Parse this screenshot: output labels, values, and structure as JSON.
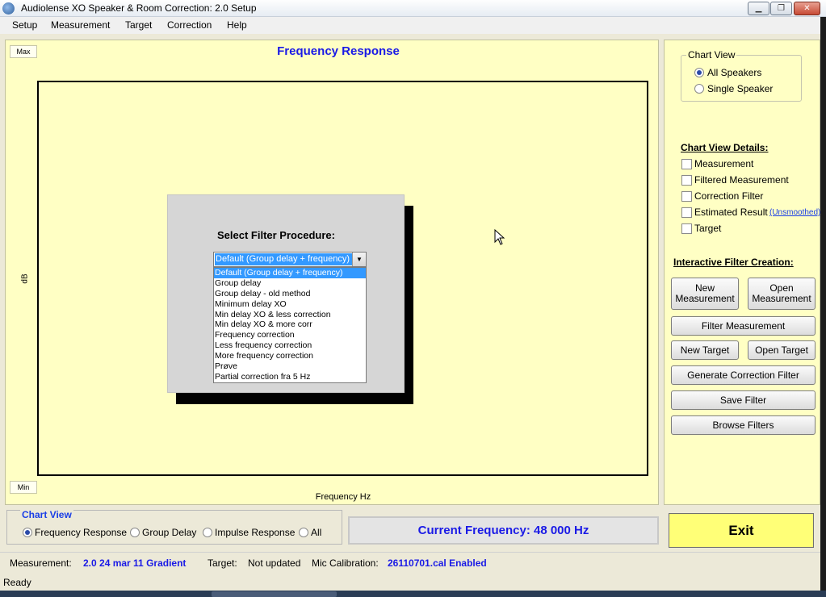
{
  "window": {
    "title": "Audiolense XO Speaker & Room Correction: 2.0 Setup"
  },
  "menu": [
    "Setup",
    "Measurement",
    "Target",
    "Correction",
    "Help"
  ],
  "chart": {
    "title": "Frequency Response",
    "max_label": "Max",
    "min_label": "Min",
    "ylabel": "dB",
    "xlabel": "Frequency Hz"
  },
  "dialog": {
    "label": "Select Filter Procedure:",
    "selected": "Default (Group delay  + frequency)",
    "options": [
      "Default (Group delay  + frequency)",
      "Group delay",
      "Group delay - old method",
      "Minimum delay XO",
      "Min delay XO & less correction",
      "Min delay XO & more corr",
      "Frequency correction",
      "Less frequency correction",
      "More frequency correction",
      "Prøve",
      "Partial correction fra 5 Hz"
    ]
  },
  "right": {
    "chart_view_title": "Chart View",
    "all_speakers": "All Speakers",
    "single_speaker": "Single Speaker",
    "details_title": "Chart View Details:",
    "measurement": "Measurement",
    "filtered_measurement": "Filtered Measurement",
    "correction_filter": "Correction Filter",
    "estimated_result": "Estimated Result",
    "unsmoothed": "(Unsmoothed)",
    "target": "Target",
    "interactive_title": "Interactive Filter Creation:",
    "new_measurement": "New Measurement",
    "open_measurement": "Open Measurement",
    "filter_measurement": "Filter Measurement",
    "new_target": "New Target",
    "open_target": "Open Target",
    "generate_filter": "Generate Correction Filter",
    "save_filter": "Save Filter",
    "browse_filters": "Browse Filters"
  },
  "bottom": {
    "chart_view_title": "Chart View",
    "frequency_response": "Frequency Response",
    "group_delay": "Group Delay",
    "impulse_response": "Impulse Response",
    "all": "All",
    "current_frequency": "Current Frequency: 48 000 Hz",
    "exit": "Exit"
  },
  "info": {
    "measurement_label": "Measurement:",
    "measurement_value": "2.0 24 mar 11 Gradient",
    "target_label": "Target:",
    "target_value": "Not updated",
    "mic_label": "Mic Calibration:",
    "mic_value": "26110701.cal Enabled"
  },
  "status": "Ready"
}
